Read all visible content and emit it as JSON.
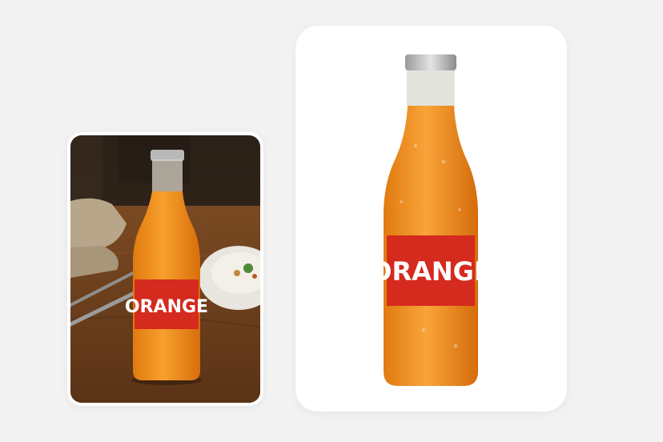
{
  "original_photo": {
    "label_text": "ORANGE"
  },
  "cutout_photo": {
    "label_text": "ORANGE"
  },
  "colors": {
    "background": "#f2f2f2",
    "card": "#ffffff",
    "juice": "#f19020",
    "label": "#d52a1e",
    "table_wood": "#6b3f1f",
    "cap": "#b9b9b9"
  }
}
